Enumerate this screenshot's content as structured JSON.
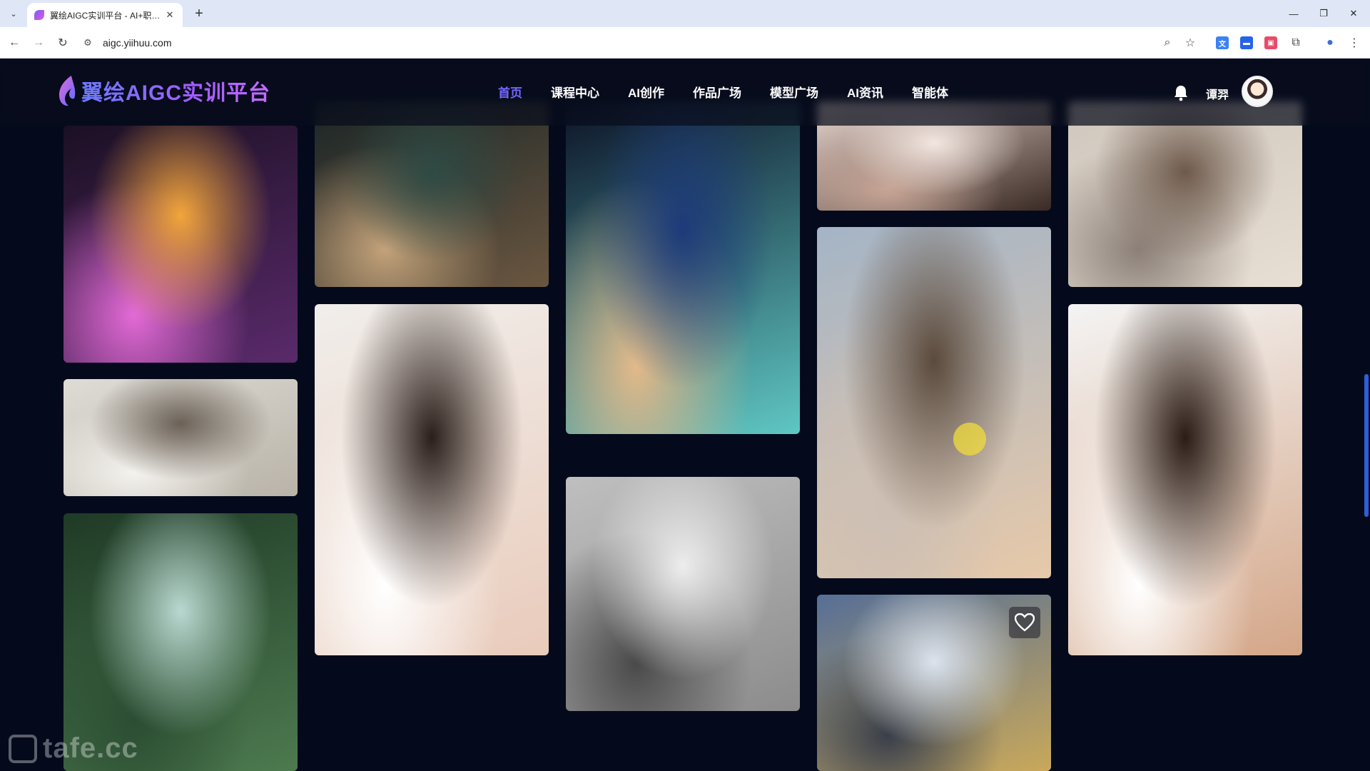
{
  "browser": {
    "tab_title": "翼绘AIGC实训平台 - AI+职业教育",
    "tab_close": "✕",
    "new_tab": "+",
    "url": "aigc.yiihuu.com",
    "window_controls": [
      "—",
      "❐",
      "✕"
    ]
  },
  "header": {
    "logo_text": "翼绘AIGC实训平台",
    "nav": [
      {
        "label": "首页",
        "active": true
      },
      {
        "label": "课程中心"
      },
      {
        "label": "AI创作"
      },
      {
        "label": "作品广场"
      },
      {
        "label": "模型广场"
      },
      {
        "label": "AI资讯"
      },
      {
        "label": "智能体"
      }
    ],
    "username": "谭羿"
  },
  "gallery": {
    "items": [
      {
        "name": "magic-potion-bottle",
        "col": 0,
        "colors": [
          "#1b1024",
          "#5a2a6a",
          "#f2a53a",
          "#e36ad6"
        ]
      },
      {
        "name": "living-room-sofa",
        "col": 0,
        "colors": [
          "#dedcd6",
          "#b9b3a8",
          "#6b6157",
          "#f4f2ee"
        ]
      },
      {
        "name": "forest-fairy",
        "col": 0,
        "colors": [
          "#1f3a26",
          "#4d7a4f",
          "#b9d8d0",
          "#2c4e33"
        ]
      },
      {
        "name": "teddy-on-pedestal",
        "col": 1,
        "colors": [
          "#1a2526",
          "#6a5640",
          "#2e4a44",
          "#c2a27a"
        ]
      },
      {
        "name": "portrait-young-woman",
        "col": 1,
        "colors": [
          "#f1eeeb",
          "#e9cbbb",
          "#2a1f1a",
          "#ffffff"
        ]
      },
      {
        "name": "cartoon-girl-blue-hair",
        "col": 2,
        "colors": [
          "#0c1226",
          "#5fc7c3",
          "#1d3a7a",
          "#e2b98a"
        ]
      },
      {
        "name": "modern-interior-gray",
        "col": 2,
        "colors": [
          "#bfbfbf",
          "#8c8c8c",
          "#ededed",
          "#4a4a4a"
        ]
      },
      {
        "name": "woman-closeup-crop",
        "col": 3,
        "colors": [
          "#ead8d0",
          "#3a2a24",
          "#f2e6e0",
          "#c7a596"
        ]
      },
      {
        "name": "girl-sunhat-mountains",
        "col": 3,
        "colors": [
          "#a4b4c6",
          "#e7c9a9",
          "#5b4a3c",
          "#cdbfb4"
        ]
      },
      {
        "name": "golden-robot-sky",
        "col": 3,
        "colors": [
          "#566f96",
          "#c9a85a",
          "#dbe3ee",
          "#3a3f4a"
        ]
      },
      {
        "name": "girl-cardigan-street",
        "col": 4,
        "colors": [
          "#cfc6bd",
          "#e8dfd3",
          "#6e5a4c",
          "#8b7f77"
        ]
      },
      {
        "name": "portrait-man-long-hair",
        "col": 4,
        "colors": [
          "#f4f4f4",
          "#d4a688",
          "#2a1d16",
          "#ffffff"
        ]
      }
    ]
  },
  "watermark": "tafe.cc",
  "colors": {
    "accent": "#7468ff",
    "page_bg": "#040a1c"
  }
}
